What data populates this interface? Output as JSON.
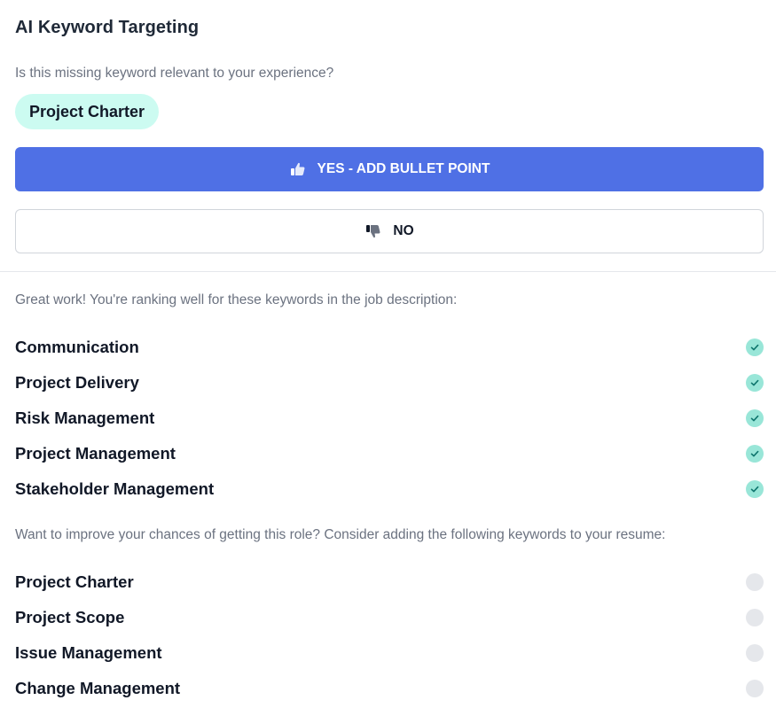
{
  "header": {
    "title": "AI Keyword Targeting"
  },
  "question": {
    "prompt": "Is this missing keyword relevant to your experience?",
    "keyword": "Project Charter"
  },
  "actions": {
    "yes_label": "YES - ADD BULLET POINT",
    "no_label": "NO"
  },
  "ranking": {
    "note": "Great work! You're ranking well for these keywords in the job description:",
    "items": [
      {
        "label": "Communication",
        "status": "matched"
      },
      {
        "label": "Project Delivery",
        "status": "matched"
      },
      {
        "label": "Risk Management",
        "status": "matched"
      },
      {
        "label": "Project Management",
        "status": "matched"
      },
      {
        "label": "Stakeholder Management",
        "status": "matched"
      }
    ]
  },
  "missing": {
    "note": "Want to improve your chances of getting this role? Consider adding the following keywords to your resume:",
    "items": [
      {
        "label": "Project Charter",
        "status": "missing"
      },
      {
        "label": "Project Scope",
        "status": "missing"
      },
      {
        "label": "Issue Management",
        "status": "missing"
      },
      {
        "label": "Change Management",
        "status": "missing"
      }
    ]
  },
  "colors": {
    "primary": "#4f70e5",
    "pill_bg": "#ccfbf1",
    "check_bg": "#99e6d8",
    "check_mark": "#0f766e",
    "empty_circle": "#e5e7eb"
  },
  "icons": {
    "yes": "thumbs-up-icon",
    "no": "thumbs-down-icon",
    "matched": "check-circle-icon",
    "missing": "empty-circle-icon"
  }
}
